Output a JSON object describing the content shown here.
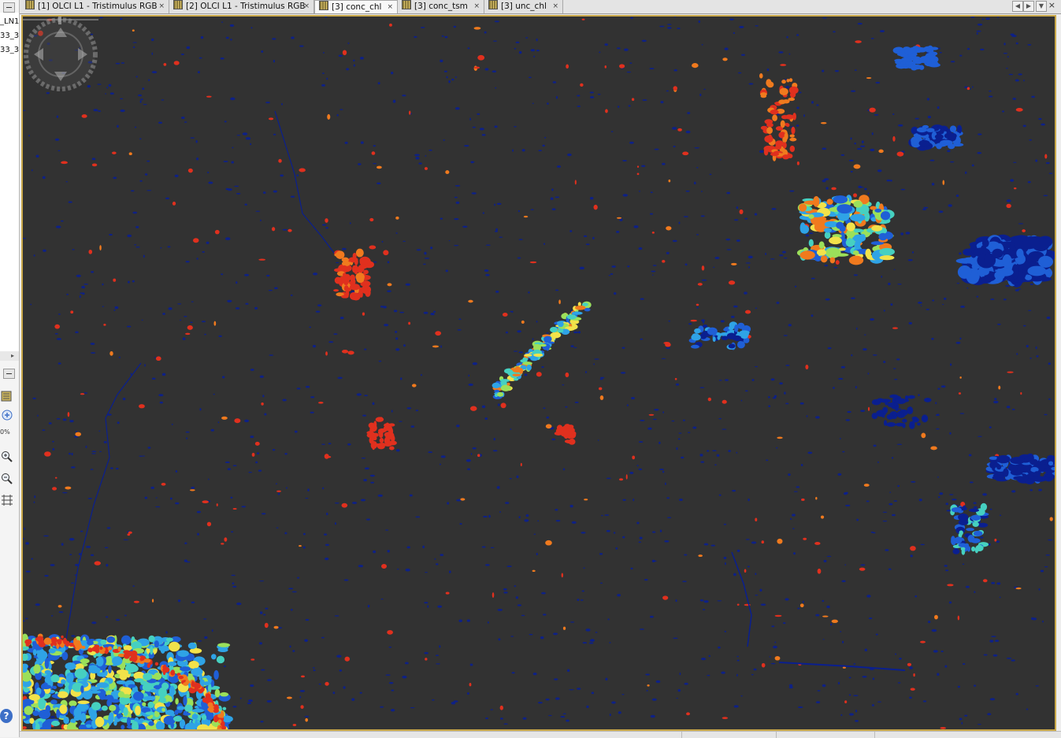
{
  "left_panel": {
    "product_rows": [
      "_LN1",
      "33_3",
      "33_3"
    ],
    "zoom_readout": "0%",
    "help_label": "?"
  },
  "tabs": [
    {
      "label": "[1] OLCI L1 - Tristimulus RGB",
      "active": false
    },
    {
      "label": "[2] OLCI L1 - Tristimulus RGB",
      "active": false
    },
    {
      "label": "[3] conc_chl",
      "active": true
    },
    {
      "label": "[3] conc_tsm",
      "active": false
    },
    {
      "label": "[3] unc_chl",
      "active": false
    }
  ],
  "tab_close_glyph": "×",
  "tab_nav": {
    "left": "◀",
    "right": "▶",
    "menu": "▼"
  },
  "image_view": {
    "band": "conc_chl",
    "background_color": "#323232",
    "frame_color": "#c9a84a",
    "palette": [
      "#0a1f8f",
      "#1f5fd6",
      "#2fa3e6",
      "#46d0c0",
      "#9be05a",
      "#f2e24a",
      "#f07a1e",
      "#e0301e"
    ]
  },
  "icons": {
    "panel_minimize": "minimize-icon",
    "pan": "pan-icon",
    "zoom_in": "zoom-in-icon",
    "zoom_out": "zoom-out-icon",
    "zoom_all": "zoom-all-icon",
    "sync": "sync-views-icon",
    "navigation": "navigation-compass-icon"
  }
}
